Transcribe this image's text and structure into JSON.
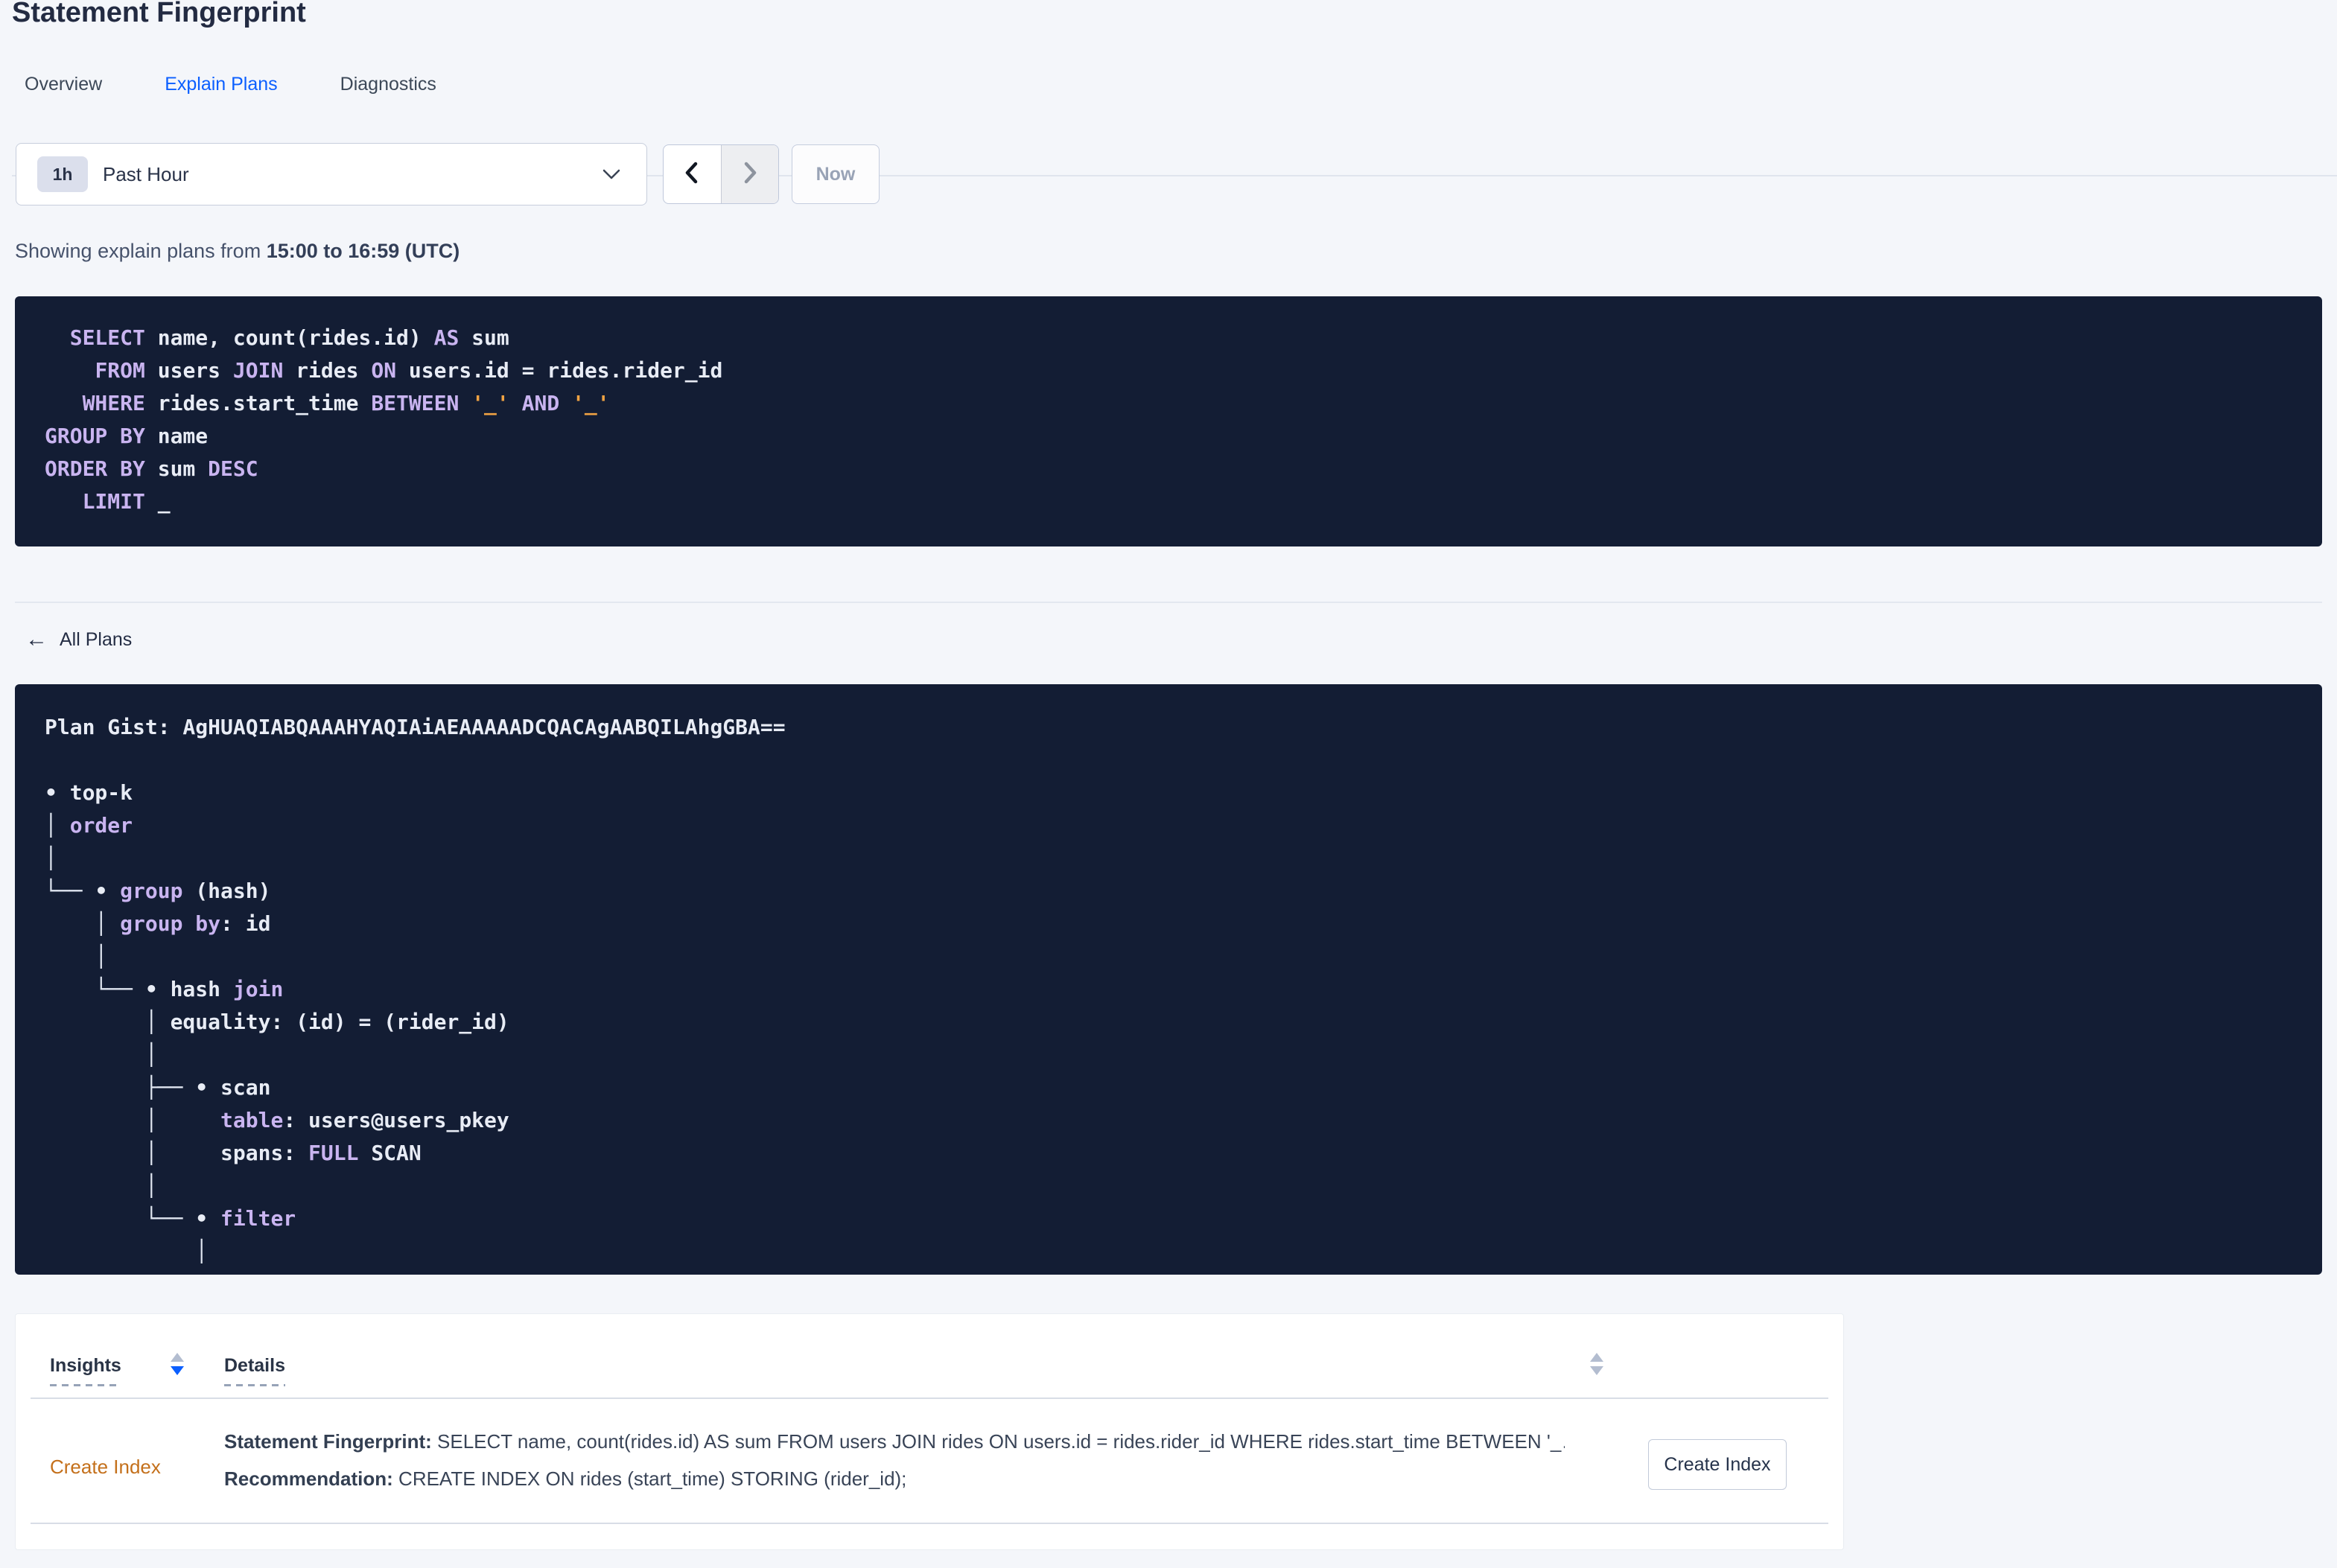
{
  "title": "Statement Fingerprint",
  "tabs": {
    "items": [
      {
        "label": "Overview",
        "active": false
      },
      {
        "label": "Explain Plans",
        "active": true
      },
      {
        "label": "Diagnostics",
        "active": false
      }
    ]
  },
  "time_picker": {
    "badge": "1h",
    "value": "Past Hour",
    "now_label": "Now"
  },
  "showing": {
    "prefix": "Showing explain plans from ",
    "range": "15:00 to 16:59 (UTC)"
  },
  "sql": {
    "lines": [
      [
        {
          "t": "  ",
          "c": "w"
        },
        {
          "t": "SELECT",
          "c": "k"
        },
        {
          "t": " name, count(rides.id) ",
          "c": "w"
        },
        {
          "t": "AS",
          "c": "k"
        },
        {
          "t": " sum",
          "c": "w"
        }
      ],
      [
        {
          "t": "    ",
          "c": "w"
        },
        {
          "t": "FROM",
          "c": "k"
        },
        {
          "t": " users ",
          "c": "w"
        },
        {
          "t": "JOIN",
          "c": "k"
        },
        {
          "t": " rides ",
          "c": "w"
        },
        {
          "t": "ON",
          "c": "k"
        },
        {
          "t": " users.id = rides.rider_id",
          "c": "w"
        }
      ],
      [
        {
          "t": "   ",
          "c": "w"
        },
        {
          "t": "WHERE",
          "c": "k"
        },
        {
          "t": " rides.start_time ",
          "c": "w"
        },
        {
          "t": "BETWEEN",
          "c": "k"
        },
        {
          "t": " ",
          "c": "w"
        },
        {
          "t": "'_'",
          "c": "s"
        },
        {
          "t": " ",
          "c": "w"
        },
        {
          "t": "AND",
          "c": "k"
        },
        {
          "t": " ",
          "c": "w"
        },
        {
          "t": "'_'",
          "c": "s"
        }
      ],
      [
        {
          "t": "GROUP BY",
          "c": "k"
        },
        {
          "t": " name",
          "c": "w"
        }
      ],
      [
        {
          "t": "ORDER BY",
          "c": "k"
        },
        {
          "t": " sum ",
          "c": "w"
        },
        {
          "t": "DESC",
          "c": "k"
        }
      ],
      [
        {
          "t": "   ",
          "c": "w"
        },
        {
          "t": "LIMIT",
          "c": "k"
        },
        {
          "t": " _",
          "c": "w"
        }
      ]
    ]
  },
  "back_link": {
    "arrow": "←",
    "label": "All Plans"
  },
  "plan": {
    "lines": [
      [
        {
          "t": "Plan Gist: AgHUAQIABQAAAHYAQIAiAEAAAAADCQACAgAABQILAhgGBA==",
          "c": "w"
        }
      ],
      [],
      [
        {
          "t": "• top-k",
          "c": "w"
        }
      ],
      [
        {
          "t": "│ ",
          "c": "b"
        },
        {
          "t": "order",
          "c": "k"
        }
      ],
      [
        {
          "t": "│",
          "c": "b"
        }
      ],
      [
        {
          "t": "└── ",
          "c": "b"
        },
        {
          "t": "• ",
          "c": "w"
        },
        {
          "t": "group",
          "c": "k"
        },
        {
          "t": " (hash)",
          "c": "w"
        }
      ],
      [
        {
          "t": "    │ ",
          "c": "b"
        },
        {
          "t": "group by",
          "c": "k"
        },
        {
          "t": ": id",
          "c": "w"
        }
      ],
      [
        {
          "t": "    │",
          "c": "b"
        }
      ],
      [
        {
          "t": "    └── ",
          "c": "b"
        },
        {
          "t": "• hash ",
          "c": "w"
        },
        {
          "t": "join",
          "c": "k"
        }
      ],
      [
        {
          "t": "        │ ",
          "c": "b"
        },
        {
          "t": "equality: (id) = (rider_id)",
          "c": "w"
        }
      ],
      [
        {
          "t": "        │",
          "c": "b"
        }
      ],
      [
        {
          "t": "        ├── ",
          "c": "b"
        },
        {
          "t": "• scan",
          "c": "w"
        }
      ],
      [
        {
          "t": "        │     ",
          "c": "b"
        },
        {
          "t": "table",
          "c": "k"
        },
        {
          "t": ": users@users_pkey",
          "c": "w"
        }
      ],
      [
        {
          "t": "        │     ",
          "c": "b"
        },
        {
          "t": "spans: ",
          "c": "w"
        },
        {
          "t": "FULL",
          "c": "k"
        },
        {
          "t": " SCAN",
          "c": "w"
        }
      ],
      [
        {
          "t": "        │",
          "c": "b"
        }
      ],
      [
        {
          "t": "        └── ",
          "c": "b"
        },
        {
          "t": "• ",
          "c": "w"
        },
        {
          "t": "filter",
          "c": "k"
        }
      ],
      [
        {
          "t": "            │",
          "c": "b"
        }
      ]
    ]
  },
  "insights_table": {
    "headers": [
      {
        "label": "Insights",
        "sort": "desc"
      },
      {
        "label": "Details",
        "sort": "none"
      }
    ],
    "row": {
      "insight": "Create Index",
      "line1_label": "Statement Fingerprint:",
      "line1_text": " SELECT name, count(rides.id) AS sum FROM users JOIN rides ON users.id = rides.rider_id WHERE rides.start_time BETWEEN '_…",
      "line2_label": "Recommendation:",
      "line2_text": " CREATE INDEX ON rides (start_time) STORING (rider_id);",
      "action_label": "Create Index"
    }
  },
  "colors": {
    "accent_blue": "#0B5FFF",
    "code_bg": "#131D34",
    "code_keyword": "#C9B4F0",
    "code_plain": "#E8ECF5",
    "code_string": "#F0A343",
    "insight_orange": "#C4701B",
    "page_bg": "#F4F6FA"
  }
}
